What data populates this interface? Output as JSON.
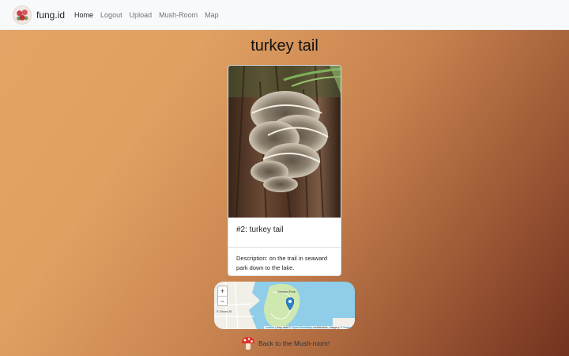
{
  "nav": {
    "brand": "fung.id",
    "brand_logo_icon": "mushroom-wreath-logo-icon",
    "links": [
      {
        "label": "Home",
        "active": true
      },
      {
        "label": "Logout",
        "active": false
      },
      {
        "label": "Upload",
        "active": false
      },
      {
        "label": "Mush-Room",
        "active": false
      },
      {
        "label": "Map",
        "active": false
      }
    ]
  },
  "page": {
    "title": "turkey tail"
  },
  "card": {
    "image_icon": "turkey-tail-mushroom-photo",
    "title": "#2: turkey tail",
    "description": "Description: on the trail in seaward park down to the lake."
  },
  "map": {
    "zoom_in": "+",
    "zoom_out": "−",
    "park_label": "Seward Park",
    "street_label": "S Orcas St",
    "attribution_leaflet": "Leaflet",
    "attribution_sep": " | Map data © ",
    "attribution_osm": "OpenStreetMap",
    "attribution_rest": " contributors, Imagery © ",
    "attribution_mapbox": "Mapbox",
    "water_color": "#8fcde8",
    "park_color": "#cfe8b0",
    "land_color": "#f2efe9",
    "marker_color": "#2a81cb"
  },
  "footer": {
    "back_label": "Back to the Mush-room!",
    "back_icon": "red-mushroom-icon"
  }
}
